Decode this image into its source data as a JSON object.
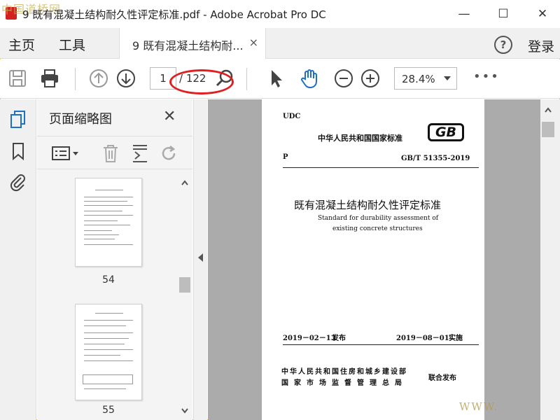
{
  "window": {
    "title": "9 既有混凝土结构耐久性评定标准.pdf - Adobe Acrobat Pro DC",
    "watermark_logo": "中国道桥网",
    "minimize": "—",
    "maximize": "☐",
    "close": "✕"
  },
  "menu": {
    "home": "主页",
    "tools": "工具",
    "login": "登录",
    "help": "?"
  },
  "tab": {
    "label": "9 既有混凝土结构耐...",
    "close": "×"
  },
  "toolbar": {
    "page_current": "1",
    "page_total": "/ 122",
    "zoom": "28.4%",
    "more": "•••"
  },
  "sidebar": {
    "panel_title": "页面缩略图",
    "close": "✕"
  },
  "thumbnails": [
    {
      "label": "54"
    },
    {
      "label": "55"
    }
  ],
  "document": {
    "udc": "UDC",
    "national_standard": "中华人民共和国国家标准",
    "gb_logo": "GB",
    "p": "P",
    "code": "GB/T 51355-2019",
    "title_cn": "既有混凝土结构耐久性评定标准",
    "title_en_1": "Standard for durability assessment of",
    "title_en_2": "existing concrete structures",
    "publish_date": "2019－02－13",
    "publish_label": "发布",
    "effective_date": "2019－08－01",
    "effective_label": "实施",
    "issuer_1": "中华人民共和国住房和城乡建设部",
    "issuer_2": "国家市场监督管理总局",
    "joint_issue": "联合发布"
  },
  "watermark_www": "WWW."
}
